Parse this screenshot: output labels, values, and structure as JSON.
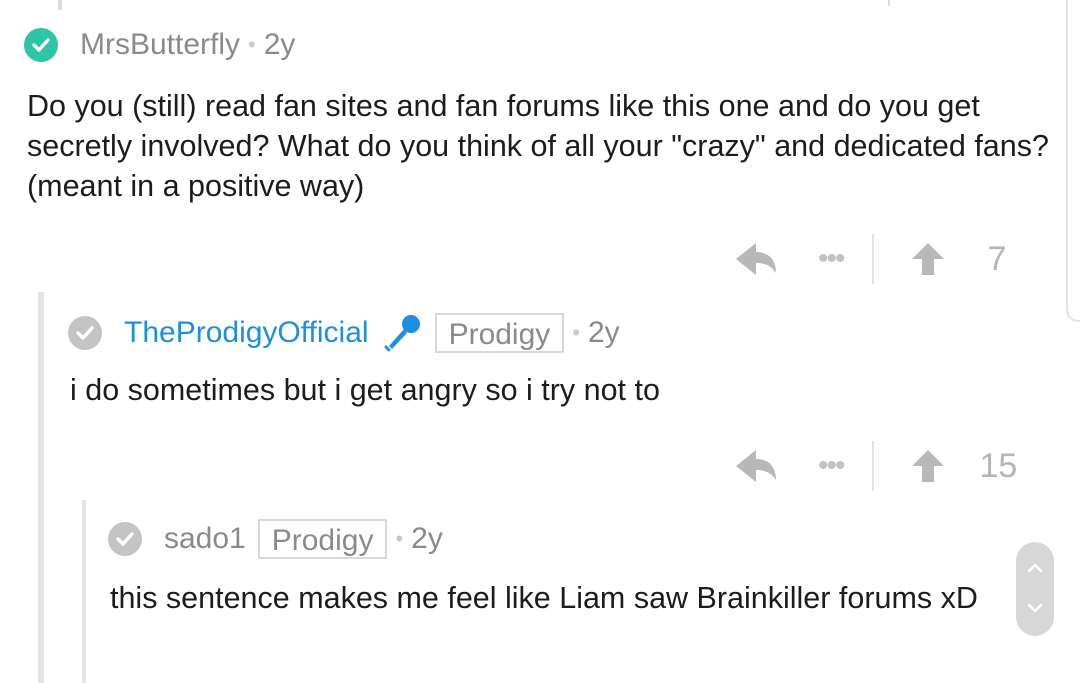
{
  "comments": [
    {
      "username": "MrsButterfly",
      "separator": "•",
      "age": "2y",
      "body": "Do you (still) read fan sites and fan forums like this one and do you get secretly involved? What do you think of all your \"crazy\" and dedicated fans? (meant in a positive way)",
      "more_label": "•••",
      "votes": "7"
    },
    {
      "username": "TheProdigyOfficial",
      "flair": "Prodigy",
      "separator": "•",
      "age": "2y",
      "body": "i do sometimes but i get angry so i try not to",
      "more_label": "•••",
      "votes": "15"
    },
    {
      "username": "sado1",
      "flair": "Prodigy",
      "separator": "•",
      "age": "2y",
      "body": "this sentence makes me feel like Liam saw Brainkiller forums xD"
    }
  ],
  "colors": {
    "verified_teal": "#2ec4a6",
    "official_blue": "#1d8fe0",
    "muted_text": "#8a8a8a"
  },
  "icons": [
    "check-icon",
    "microphone-icon",
    "reply-arrow-icon",
    "more-icon",
    "upvote-arrow-icon",
    "chevron-up-icon",
    "chevron-down-icon"
  ]
}
